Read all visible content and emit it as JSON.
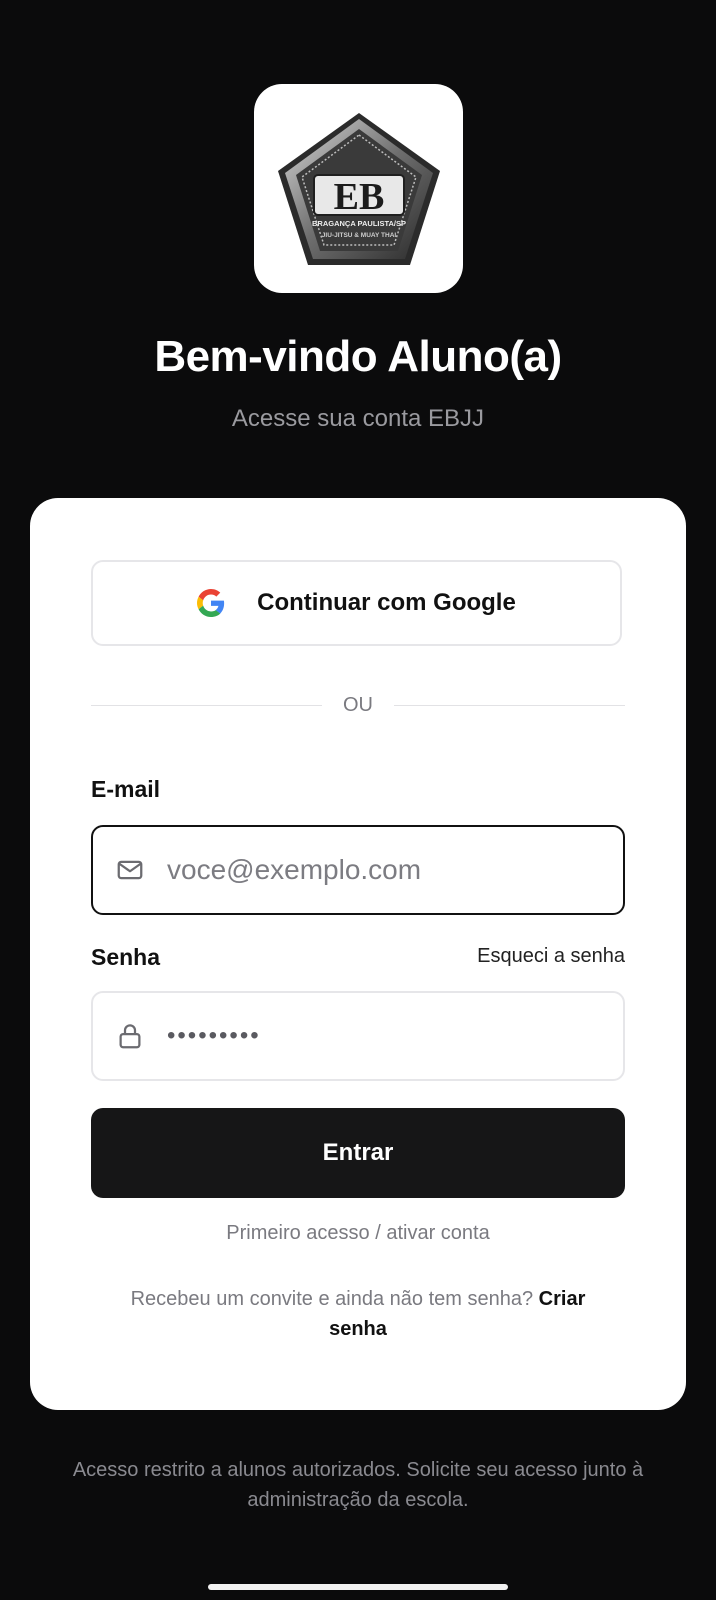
{
  "logo": {
    "text_main": "EB",
    "text_line1": "BRAGANÇA PAULISTA/SP",
    "text_line2": "JIU-JITSU & MUAY THAI"
  },
  "header": {
    "title": "Bem-vindo Aluno(a)",
    "subtitle": "Acesse sua conta EBJJ"
  },
  "google": {
    "label": "Continuar com Google",
    "icon": "google-icon"
  },
  "divider": {
    "text": "OU"
  },
  "email": {
    "label": "E-mail",
    "placeholder": "voce@exemplo.com",
    "icon": "mail-icon"
  },
  "password": {
    "label": "Senha",
    "value": "•••••••••",
    "forgot": "Esqueci a senha",
    "icon": "lock-icon"
  },
  "actions": {
    "submit": "Entrar",
    "first_access": "Primeiro acesso / ativar conta"
  },
  "invite": {
    "text": "Recebeu um convite e ainda não tem senha?",
    "link": "Criar senha"
  },
  "footer": {
    "text": "Acesso restrito a alunos autorizados. Solicite seu acesso junto à administração da escola."
  },
  "colors": {
    "background": "#0b0b0c",
    "card": "#ffffff",
    "primary_button": "#161617"
  }
}
